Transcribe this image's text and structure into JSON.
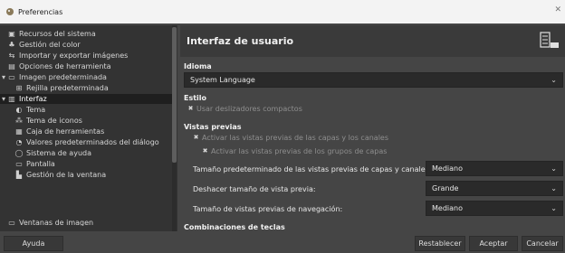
{
  "window": {
    "title": "Preferencias"
  },
  "tree": {
    "items": [
      {
        "label": "Recursos del sistema",
        "icon": "chip-icon"
      },
      {
        "label": "Gestión del color",
        "icon": "color-icon"
      },
      {
        "label": "Importar y exportar imágenes",
        "icon": "import-icon"
      },
      {
        "label": "Opciones de herramienta",
        "icon": "tool-options-icon"
      },
      {
        "label": "Imagen predeterminada",
        "icon": "image-icon"
      },
      {
        "label": "Rejilla predeterminada",
        "icon": "grid-icon"
      },
      {
        "label": "Interfaz",
        "icon": "interface-icon"
      },
      {
        "label": "Tema",
        "icon": "theme-icon"
      },
      {
        "label": "Tema de iconos",
        "icon": "icon-theme-icon"
      },
      {
        "label": "Caja de herramientas",
        "icon": "toolbox-icon"
      },
      {
        "label": "Valores predeterminados del diálogo",
        "icon": "dialog-defaults-icon"
      },
      {
        "label": "Sistema de ayuda",
        "icon": "help-system-icon"
      },
      {
        "label": "Pantalla",
        "icon": "display-icon"
      },
      {
        "label": "Gestión de la ventana",
        "icon": "window-icon"
      },
      {
        "label": "Ventanas de imagen",
        "icon": "image-windows-icon"
      }
    ]
  },
  "panel": {
    "title": "Interfaz de usuario",
    "idioma": {
      "heading": "Idioma",
      "value": "System Language"
    },
    "estilo": {
      "heading": "Estilo",
      "compact_label": "Usar deslizadores compactos"
    },
    "vistas": {
      "heading": "Vistas previas",
      "layers_label": "Activar las vistas previas de las capas y los canales",
      "groups_label": "Activar las vistas previas de los grupos de capas",
      "size_label": "Tamaño predeterminado de las vistas previas de capas y canales:",
      "size_value": "Mediano",
      "undo_label": "Deshacer tamaño de vista previa:",
      "undo_value": "Grande",
      "nav_label": "Tamaño de vistas previas de navegación:",
      "nav_value": "Mediano"
    },
    "next_heading": "Combinaciones de teclas"
  },
  "footer": {
    "help": "Ayuda",
    "reset": "Restablecer",
    "accept": "Aceptar",
    "cancel": "Cancelar"
  }
}
